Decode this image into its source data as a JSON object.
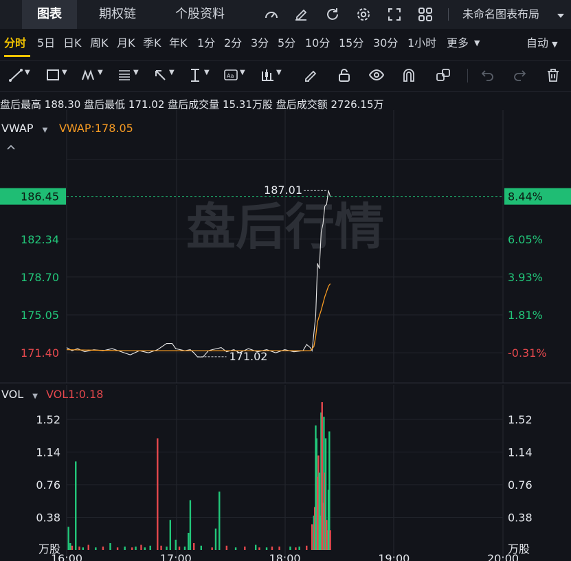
{
  "top_tabs": {
    "chart": "图表",
    "options": "期权链",
    "profile": "个股资料",
    "layout": "未命名图表布局"
  },
  "top_icons": [
    "gauge-icon",
    "pencil-edit-icon",
    "refresh-icon",
    "settings-gear-icon",
    "fullscreen-icon",
    "grid-layout-icon",
    "chevron-down-icon"
  ],
  "periods": [
    "分时",
    "5日",
    "日K",
    "周K",
    "月K",
    "季K",
    "年K",
    "1分",
    "2分",
    "3分",
    "5分",
    "10分",
    "15分",
    "30分",
    "1小时",
    "更多"
  ],
  "active_period": "分时",
  "auto_label": "自动",
  "toolbar_icons": [
    "trend-line-icon",
    "rectangle-icon",
    "wave-pattern-icon",
    "fib-levels-icon",
    "arrow-icon",
    "vertical-range-icon",
    "text-annotation-icon",
    "candle-pattern-icon",
    "brush-icon",
    "unlock-icon",
    "eye-icon",
    "magnet-icon",
    "duplicate-icon",
    "undo-icon",
    "redo-icon",
    "trash-icon"
  ],
  "info": {
    "high_label": "盘后最高",
    "high_value": "188.30",
    "low_label": "盘后最低",
    "low_value": "171.02",
    "vol_label": "盘后成交量",
    "vol_value": "15.31万股",
    "amount_label": "盘后成交额",
    "amount_value": "2726.15万"
  },
  "indicator": {
    "name": "VWAP",
    "value_label": "VWAP:178.05"
  },
  "watermark": "盘后行情",
  "price_axis": {
    "current": "186.45",
    "left_ticks": [
      "182.34",
      "178.70",
      "175.05",
      "171.40"
    ],
    "right_current": "8.44%",
    "right_ticks": [
      "6.05%",
      "3.93%",
      "1.81%",
      "-0.31%"
    ]
  },
  "annotations": {
    "high": "187.01",
    "low": "171.02"
  },
  "volume": {
    "name": "VOL",
    "value_label": "VOL1:0.18",
    "ticks": [
      "1.52",
      "1.14",
      "0.76",
      "0.38"
    ],
    "unit": "万股"
  },
  "time_axis": [
    "16:00",
    "17:00",
    "18:00",
    "19:00",
    "20:00"
  ],
  "colors": {
    "up": "#e5484d",
    "down": "#22c77a",
    "vwap": "#f59a23",
    "price": "#e8e8e8",
    "accent": "#f2c300",
    "current_bg": "#1fbd74"
  },
  "chart_data": {
    "type": "line",
    "price_range": [
      168.5,
      190.0
    ],
    "volume_range": [
      0,
      1.72
    ],
    "time_range": [
      "16:00",
      "20:00"
    ],
    "grid": true,
    "price": [
      [
        "16:00",
        171.9
      ],
      [
        "16:03",
        171.6
      ],
      [
        "16:06",
        171.8
      ],
      [
        "16:10",
        171.5
      ],
      [
        "16:15",
        171.7
      ],
      [
        "16:20",
        171.6
      ],
      [
        "16:25",
        171.8
      ],
      [
        "16:30",
        171.5
      ],
      [
        "16:35",
        171.2
      ],
      [
        "16:40",
        171.6
      ],
      [
        "16:45",
        171.4
      ],
      [
        "16:50",
        171.7
      ],
      [
        "16:55",
        172.3
      ],
      [
        "16:58",
        172.3
      ],
      [
        "17:00",
        171.8
      ],
      [
        "17:05",
        171.6
      ],
      [
        "17:08",
        171.7
      ],
      [
        "17:10",
        171.4
      ],
      [
        "17:12",
        171.0
      ],
      [
        "17:15",
        171.0
      ],
      [
        "17:18",
        171.6
      ],
      [
        "17:20",
        171.7
      ],
      [
        "17:25",
        171.9
      ],
      [
        "17:28",
        171.5
      ],
      [
        "17:32",
        171.7
      ],
      [
        "17:35",
        171.4
      ],
      [
        "17:40",
        171.8
      ],
      [
        "17:45",
        171.5
      ],
      [
        "17:50",
        171.7
      ],
      [
        "17:55",
        171.4
      ],
      [
        "18:00",
        171.7
      ],
      [
        "18:05",
        171.5
      ],
      [
        "18:10",
        171.6
      ],
      [
        "18:12",
        172.2
      ],
      [
        "18:14",
        171.9
      ],
      [
        "18:15",
        171.6
      ],
      [
        "18:16",
        173.3
      ],
      [
        "18:17",
        175.0
      ],
      [
        "18:18",
        180.0
      ],
      [
        "18:19",
        179.5
      ],
      [
        "18:20",
        183.0
      ],
      [
        "18:21",
        183.8
      ],
      [
        "18:22",
        185.5
      ],
      [
        "18:23",
        185.7
      ],
      [
        "18:24",
        187.01
      ],
      [
        "18:25",
        186.45
      ]
    ],
    "vwap": [
      [
        "16:00",
        171.7
      ],
      [
        "16:30",
        171.6
      ],
      [
        "17:00",
        171.6
      ],
      [
        "17:30",
        171.6
      ],
      [
        "18:00",
        171.6
      ],
      [
        "18:14",
        171.6
      ],
      [
        "18:16",
        172.0
      ],
      [
        "18:17",
        173.0
      ],
      [
        "18:18",
        174.4
      ],
      [
        "18:20",
        175.5
      ],
      [
        "18:22",
        176.8
      ],
      [
        "18:24",
        177.8
      ],
      [
        "18:25",
        178.05
      ]
    ],
    "volume": [
      [
        "16:01",
        0.27,
        "down"
      ],
      [
        "16:02",
        0.08,
        "down"
      ],
      [
        "16:03",
        0.05,
        "up"
      ],
      [
        "16:05",
        1.03,
        "down"
      ],
      [
        "16:07",
        0.04,
        "up"
      ],
      [
        "16:09",
        0.03,
        "down"
      ],
      [
        "16:12",
        0.06,
        "up"
      ],
      [
        "16:16",
        0.03,
        "down"
      ],
      [
        "16:20",
        0.04,
        "up"
      ],
      [
        "16:24",
        0.08,
        "down"
      ],
      [
        "16:28",
        0.03,
        "up"
      ],
      [
        "16:32",
        0.04,
        "down"
      ],
      [
        "16:36",
        0.03,
        "up"
      ],
      [
        "16:38",
        0.04,
        "down"
      ],
      [
        "16:41",
        0.06,
        "up"
      ],
      [
        "16:43",
        0.03,
        "down"
      ],
      [
        "16:46",
        0.05,
        "down"
      ],
      [
        "16:50",
        1.3,
        "up"
      ],
      [
        "16:52",
        0.05,
        "up"
      ],
      [
        "16:55",
        0.04,
        "down"
      ],
      [
        "16:57",
        0.35,
        "down"
      ],
      [
        "17:00",
        0.12,
        "down"
      ],
      [
        "17:02",
        0.04,
        "up"
      ],
      [
        "17:05",
        0.04,
        "down"
      ],
      [
        "17:07",
        0.2,
        "down"
      ],
      [
        "17:08",
        0.58,
        "down"
      ],
      [
        "17:10",
        0.08,
        "up"
      ],
      [
        "17:14",
        0.05,
        "down"
      ],
      [
        "17:20",
        0.03,
        "up"
      ],
      [
        "17:22",
        0.25,
        "down"
      ],
      [
        "17:24",
        0.68,
        "down"
      ],
      [
        "17:28",
        0.05,
        "up"
      ],
      [
        "17:33",
        0.03,
        "down"
      ],
      [
        "17:38",
        0.04,
        "up"
      ],
      [
        "17:44",
        0.06,
        "down"
      ],
      [
        "17:46",
        0.03,
        "up"
      ],
      [
        "17:50",
        0.03,
        "down"
      ],
      [
        "17:53",
        0.04,
        "up"
      ],
      [
        "17:57",
        0.04,
        "up"
      ],
      [
        "18:03",
        0.04,
        "down"
      ],
      [
        "18:06",
        0.03,
        "up"
      ],
      [
        "18:08",
        0.04,
        "down"
      ],
      [
        "18:12",
        0.05,
        "up"
      ],
      [
        "18:15",
        0.3,
        "up"
      ],
      [
        "18:16",
        0.4,
        "down"
      ],
      [
        "18:16.5",
        0.5,
        "up"
      ],
      [
        "18:17",
        1.45,
        "down"
      ],
      [
        "18:17.5",
        1.3,
        "down"
      ],
      [
        "18:18",
        0.85,
        "up"
      ],
      [
        "18:18.5",
        1.1,
        "up"
      ],
      [
        "18:19",
        0.9,
        "down"
      ],
      [
        "18:19.5",
        0.4,
        "down"
      ],
      [
        "18:20",
        1.6,
        "down"
      ],
      [
        "18:20.5",
        1.72,
        "up"
      ],
      [
        "18:21",
        0.55,
        "up"
      ],
      [
        "18:21.5",
        1.55,
        "down"
      ],
      [
        "18:22",
        0.9,
        "up"
      ],
      [
        "18:22.5",
        1.3,
        "down"
      ],
      [
        "18:23",
        0.35,
        "up"
      ],
      [
        "18:23.5",
        0.23,
        "up"
      ],
      [
        "18:24",
        0.7,
        "down"
      ],
      [
        "18:24.5",
        1.38,
        "down"
      ],
      [
        "18:25",
        0.23,
        "up"
      ]
    ]
  }
}
